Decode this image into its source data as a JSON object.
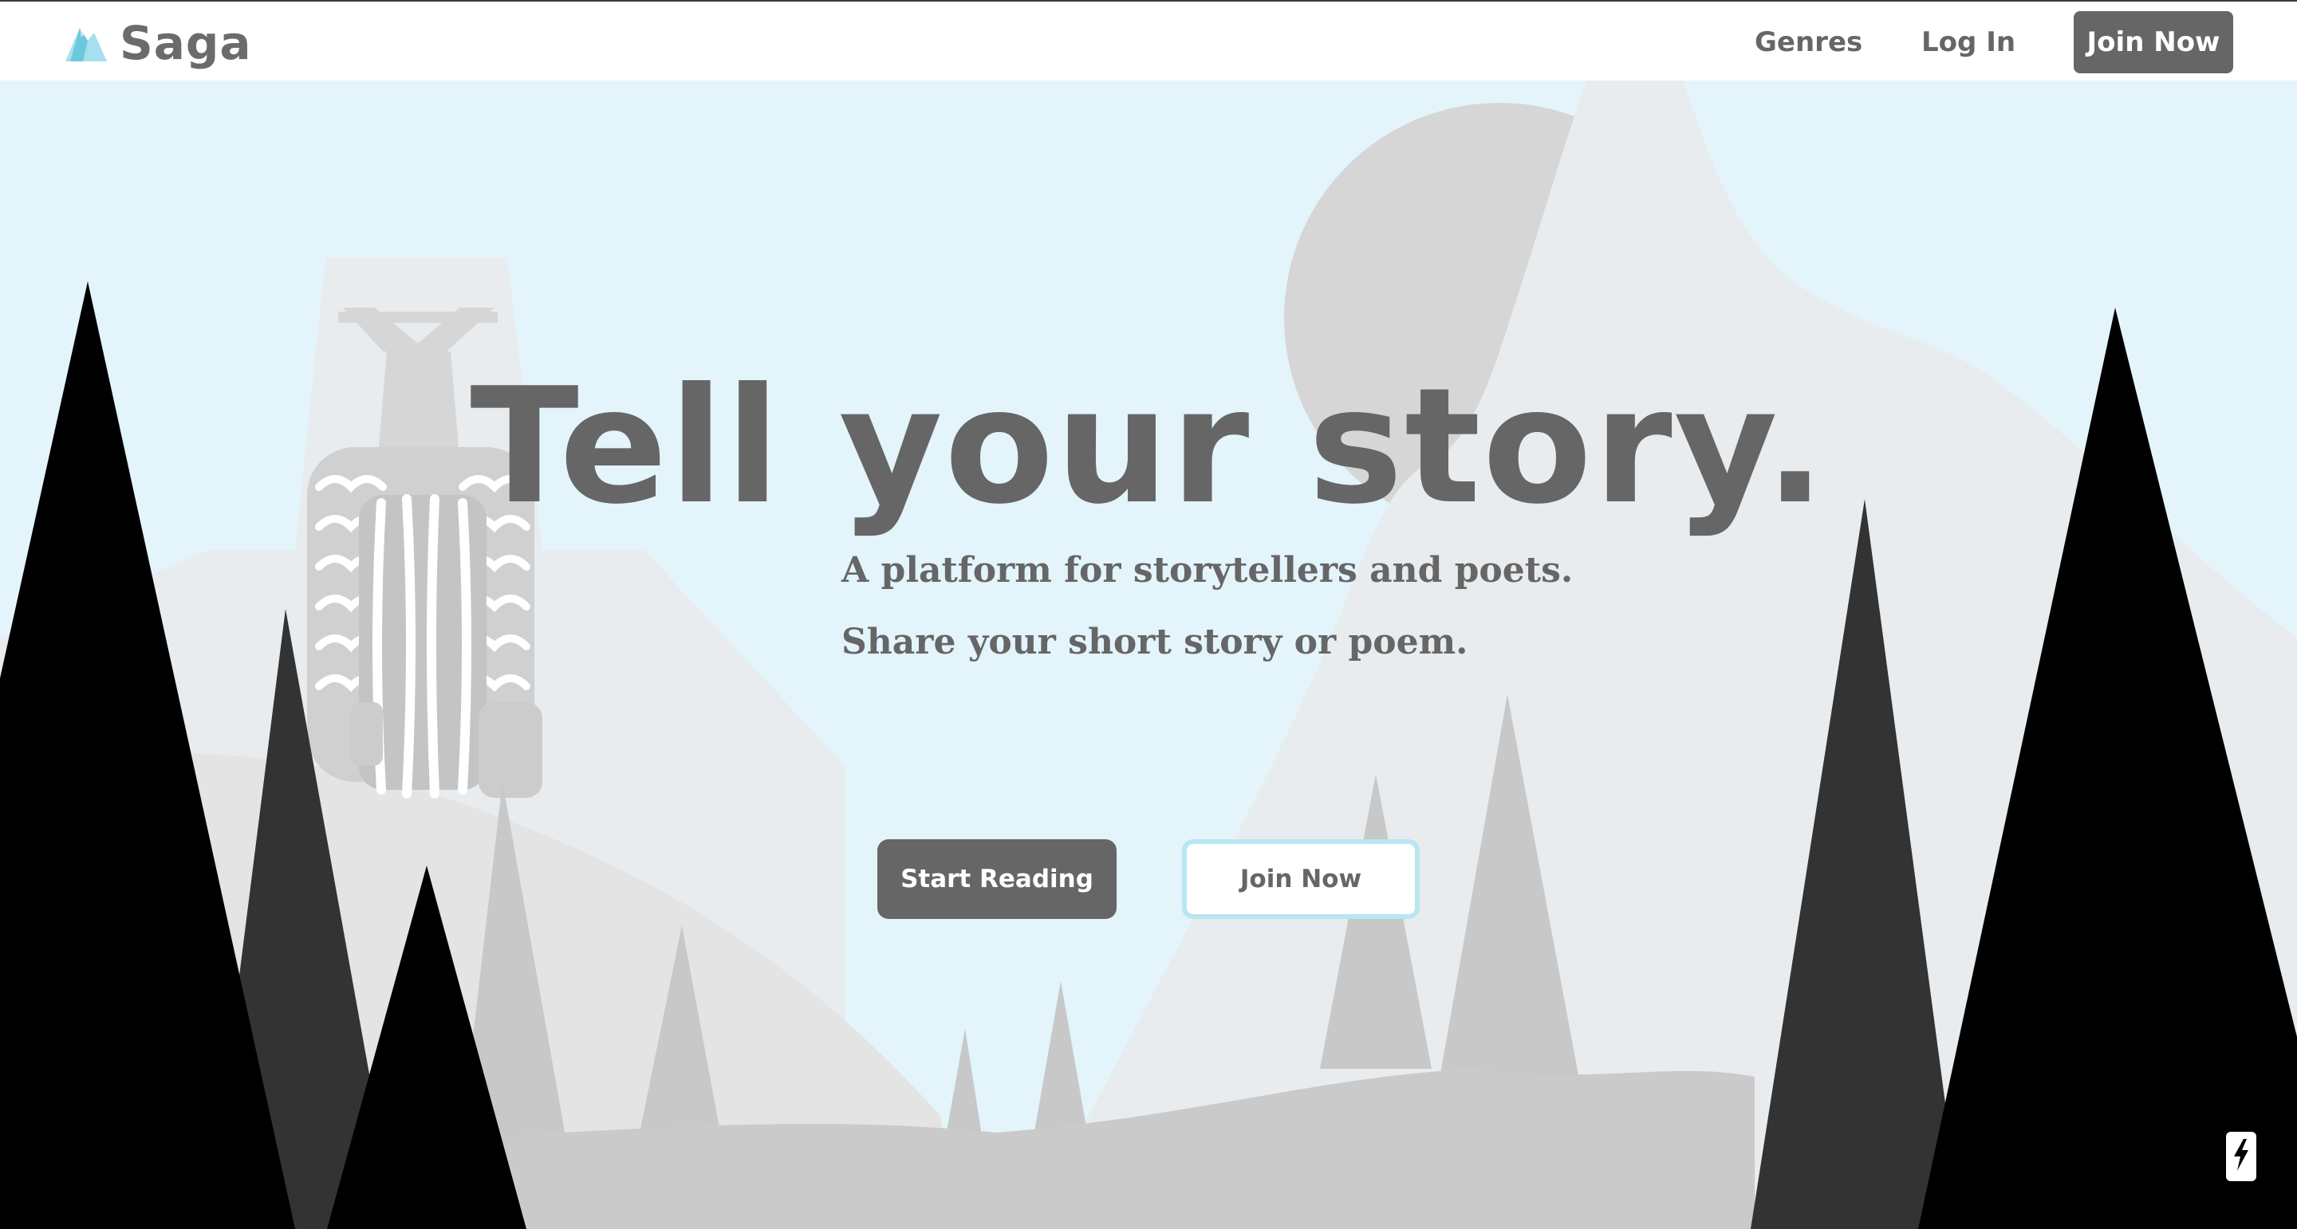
{
  "nav": {
    "brand": "Saga",
    "links": [
      {
        "label": "Genres"
      },
      {
        "label": "Log In"
      }
    ],
    "join_label": "Join Now"
  },
  "hero": {
    "headline": "Tell your story.",
    "taglines": [
      "A platform for storytellers and poets.",
      "Share your short story or poem."
    ],
    "primary_cta": "Start Reading",
    "secondary_cta": "Join Now"
  },
  "icons": {
    "logo": "mountain-logo-icon",
    "floating": "lightning-bolt-icon"
  },
  "colors": {
    "sky": "#e3f4fb",
    "accent": "#a6dfee",
    "text": "#666666",
    "tree_dark": "#000000",
    "tree_mid": "#333333",
    "tree_light": "#c8c8c8",
    "moon": "#d6d6d6",
    "ground": "#cacaca",
    "button_outline": "#b8e6f2"
  }
}
